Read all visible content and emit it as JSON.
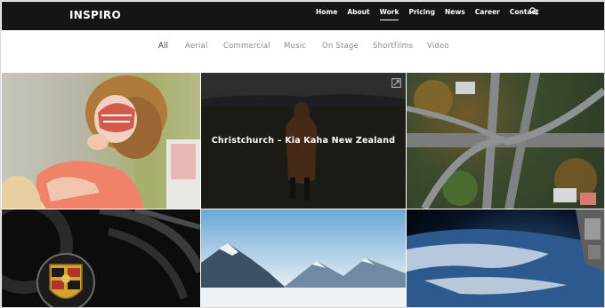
{
  "header": {
    "logo": "INSPIRO",
    "nav": [
      {
        "label": "Home"
      },
      {
        "label": "About"
      },
      {
        "label": "Work",
        "active": true
      },
      {
        "label": "Pricing"
      },
      {
        "label": "News"
      },
      {
        "label": "Career"
      },
      {
        "label": "Contact"
      }
    ],
    "search_icon": "search-icon"
  },
  "filters": [
    "All",
    "Aerial",
    "Commercial",
    "Music",
    "On Stage",
    "Shortfilms",
    "Video"
  ],
  "active_filter": "All",
  "portfolio": {
    "hover_title": "Christchurch – Kia Kaha New Zealand",
    "expand_icon": "expand-icon"
  },
  "colors": {
    "header_bg": "#151515",
    "filter_text": "#8c8c8c",
    "filter_active": "#333333"
  }
}
